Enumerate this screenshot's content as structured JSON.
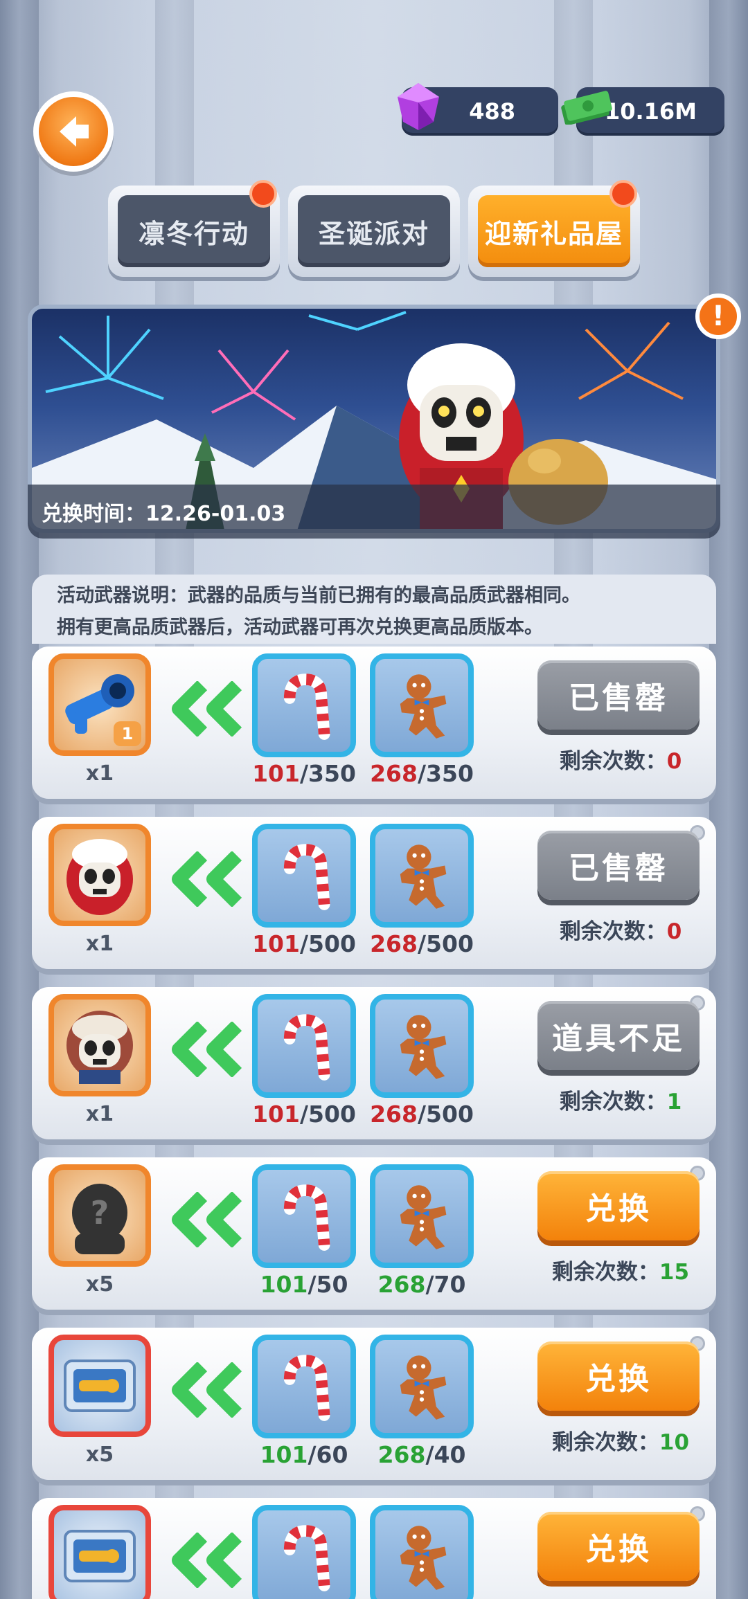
{
  "header": {
    "gems": "488",
    "cash": "10.16M"
  },
  "tabs": [
    {
      "label": "凛冬行动",
      "active": false,
      "dot": true
    },
    {
      "label": "圣诞派对",
      "active": false,
      "dot": false
    },
    {
      "label": "迎新礼品屋",
      "active": true,
      "dot": true
    }
  ],
  "banner": {
    "exchange_time": "兑换时间：12.26-01.03",
    "info_glyph": "!"
  },
  "description": {
    "line1": "活动武器说明：武器的品质与当前已拥有的最高品质武器相同。",
    "line2": "拥有更高品质武器后，活动武器可再次兑换更高品质版本。"
  },
  "remain_label": "剩余次数：",
  "rows": [
    {
      "reward_icon": "blaster-gun-icon",
      "reward_badge": "1",
      "reward_qty": "x1",
      "mat1_have": "101",
      "mat1_need": "/350",
      "mat1_color": "red",
      "mat2_have": "268",
      "mat2_need": "/350",
      "mat2_color": "red",
      "action": "已售罄",
      "action_style": "gray",
      "remain": "0"
    },
    {
      "reward_icon": "santa-skull-character-icon",
      "reward_qty": "x1",
      "mat1_have": "101",
      "mat1_need": "/500",
      "mat1_color": "red",
      "mat2_have": "268",
      "mat2_need": "/500",
      "mat2_color": "red",
      "action": "已售罄",
      "action_style": "gray",
      "remain": "0"
    },
    {
      "reward_icon": "hooded-skull-character-icon",
      "reward_qty": "x1",
      "mat1_have": "101",
      "mat1_need": "/500",
      "mat1_color": "red",
      "mat2_have": "268",
      "mat2_need": "/500",
      "mat2_color": "red",
      "action": "道具不足",
      "action_style": "gray",
      "remain": "1"
    },
    {
      "reward_icon": "mystery-character-icon",
      "reward_qty": "x5",
      "mat1_have": "101",
      "mat1_need": "/50",
      "mat1_color": "green",
      "mat2_have": "268",
      "mat2_need": "/70",
      "mat2_color": "green",
      "action": "兑换",
      "action_style": "orange",
      "remain": "15"
    },
    {
      "reward_icon": "weapon-crate-icon",
      "reward_qty": "x5",
      "mat1_have": "101",
      "mat1_need": "/60",
      "mat1_color": "green",
      "mat2_have": "268",
      "mat2_need": "/40",
      "mat2_color": "green",
      "action": "兑换",
      "action_style": "orange",
      "remain": "10"
    },
    {
      "reward_icon": "weapon-crate-icon",
      "reward_qty": "",
      "mat1_have": "",
      "mat1_need": "",
      "mat2_have": "",
      "mat2_need": "",
      "action": "兑换",
      "action_style": "orange",
      "remain": ""
    }
  ],
  "materials": [
    "candy-cane-icon",
    "gingerbread-man-icon"
  ],
  "colors": {
    "accent_orange": "#f3820b",
    "need_red": "#c8262b",
    "ok_green": "#29a234",
    "mat_border": "#33b4e6"
  }
}
